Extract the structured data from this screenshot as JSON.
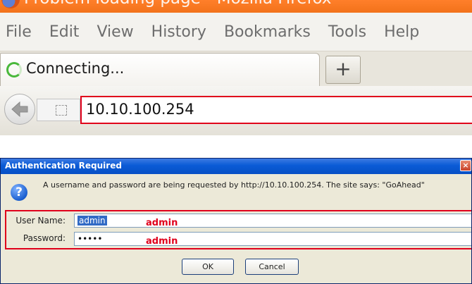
{
  "browser": {
    "window_title": "Problem loading page - Mozilla Firefox",
    "menu": [
      "File",
      "Edit",
      "View",
      "History",
      "Bookmarks",
      "Tools",
      "Help"
    ],
    "tab": {
      "title": "Connecting...",
      "new_tab_label": "+"
    },
    "address": {
      "url": "10.10.100.254"
    },
    "icons": [
      "firefox-logo",
      "loading-spinner",
      "back-arrow-icon",
      "site-identity-icon",
      "new-tab-icon"
    ]
  },
  "dialog": {
    "title": "Authentication Required",
    "message": "A username and password are being requested by http://10.10.100.254. The site says: \"GoAhead\"",
    "username_label": "User Name:",
    "username_value": "admin",
    "password_label": "Password:",
    "password_value": "•••••",
    "username_annotation": "admin",
    "password_annotation": "admin",
    "ok_label": "OK",
    "cancel_label": "Cancel",
    "close_glyph": "×",
    "question_glyph": "?"
  },
  "colors": {
    "highlight_border": "#e0001b",
    "dialog_titlebar": "#0a5bd6",
    "dialog_background": "#ece9d8",
    "firefox_titlebar": "#f2721a"
  }
}
